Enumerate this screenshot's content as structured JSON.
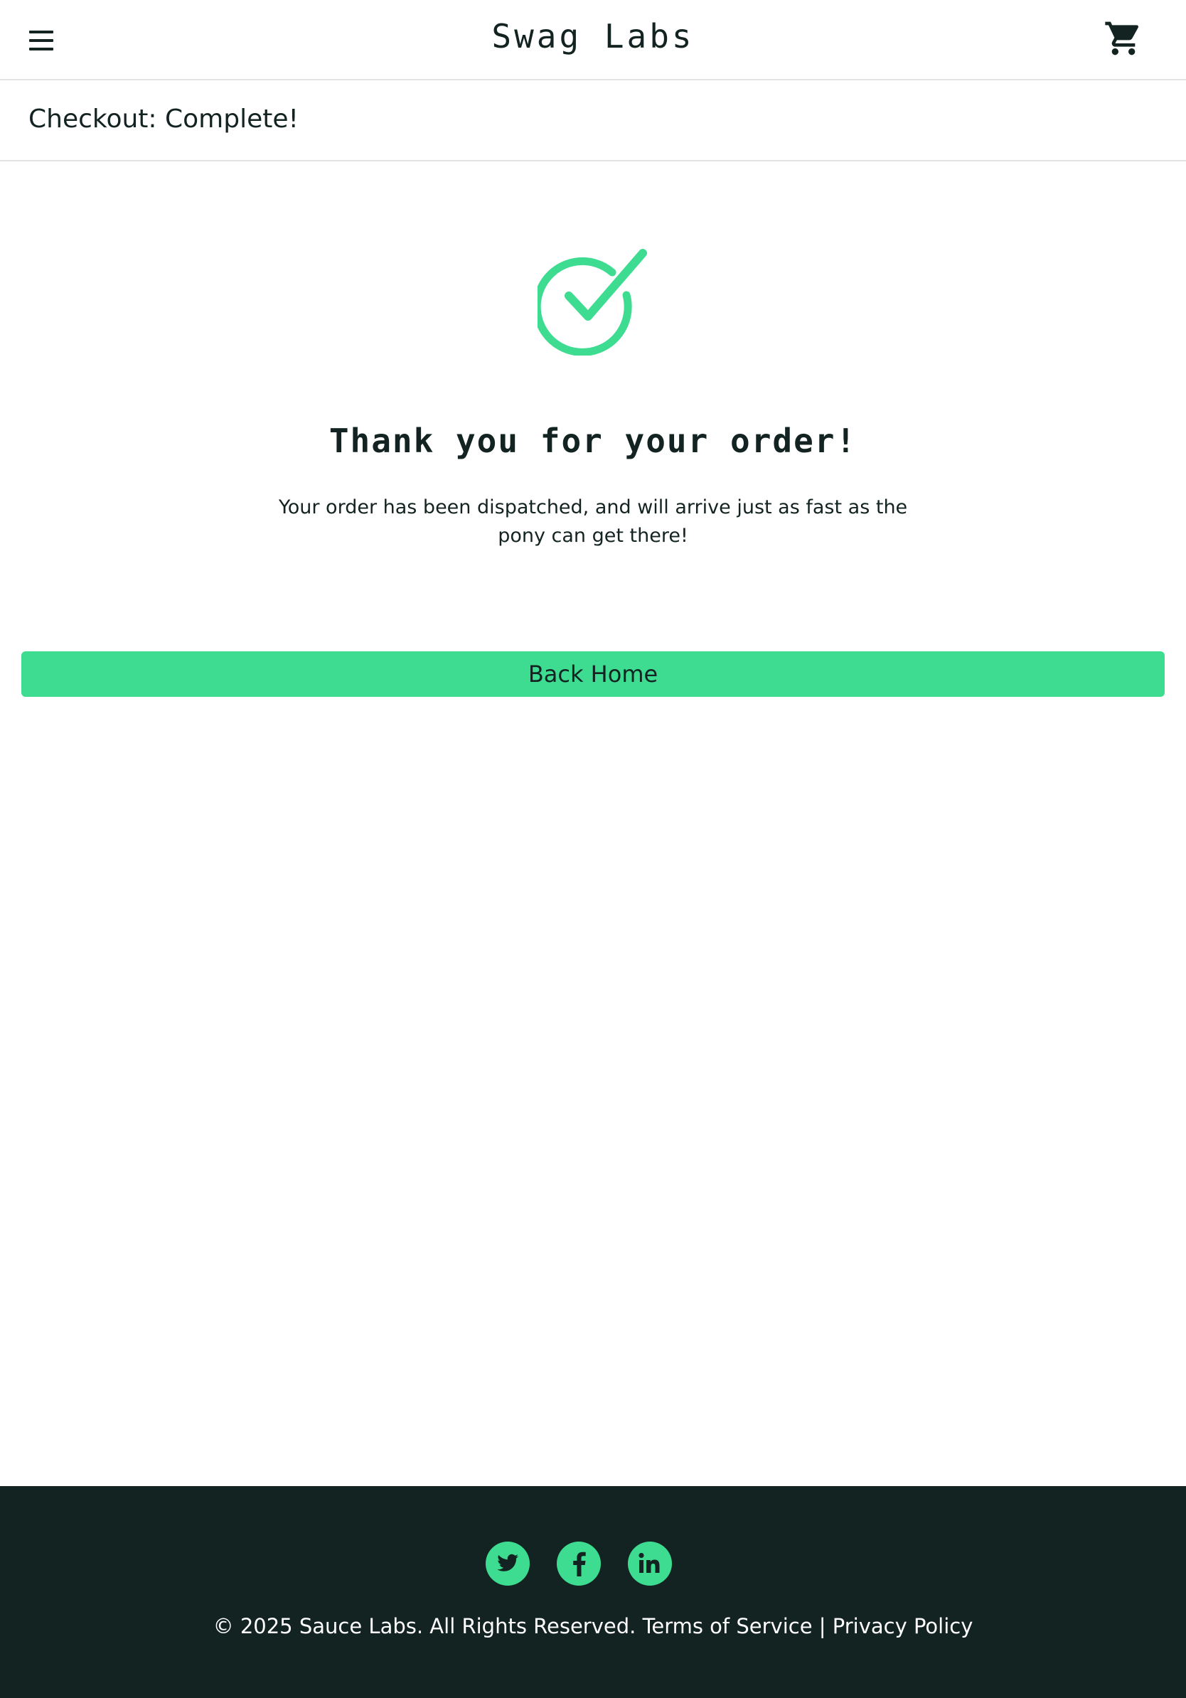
{
  "header": {
    "menu_label": "Open Menu",
    "logo": "Swag Labs",
    "cart_icon": "shopping-cart-icon"
  },
  "secondary_header": {
    "title": "Checkout: Complete!"
  },
  "complete": {
    "icon": "checkmark-circle-icon",
    "header": "Thank you for your order!",
    "text": "Your order has been dispatched, and will arrive just as fast as the pony can get there!",
    "back_home_label": "Back Home"
  },
  "footer": {
    "social": [
      "twitter-icon",
      "facebook-icon",
      "linkedin-icon"
    ],
    "copyright": "© 2025 Sauce Labs. All Rights Reserved. Terms of Service | Privacy Policy"
  },
  "colors": {
    "accent": "#3ddc91",
    "text": "#132322",
    "footer_bg": "#132322",
    "divider": "#e3e3e3"
  }
}
